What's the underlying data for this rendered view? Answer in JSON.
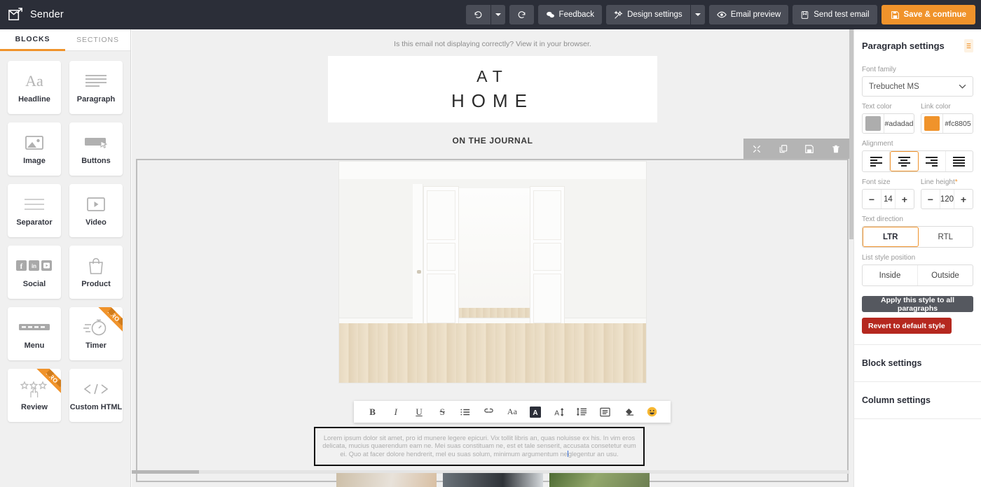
{
  "app": {
    "brand_name": "Sender",
    "brand_logo_icon": "envelope-arrow-icon"
  },
  "topbar": {
    "undo_icon": "undo-icon",
    "undo_dropdown_icon": "chevron-down-icon",
    "redo_icon": "redo-icon",
    "feedback_label": "Feedback",
    "feedback_icon": "chat-bubble-icon",
    "design_settings_label": "Design settings",
    "design_settings_icon": "wand-icon",
    "design_settings_dropdown_icon": "chevron-down-icon",
    "email_preview_label": "Email preview",
    "email_preview_icon": "eye-icon",
    "send_test_email_label": "Send test email",
    "send_test_email_icon": "paper-plane-icon",
    "save_label": "Save & continue",
    "save_icon": "floppy-disk-icon",
    "accent_color": "#f0932b",
    "bar_color": "#2b2e38"
  },
  "sidebar": {
    "tabs": [
      {
        "label": "BLOCKS",
        "active": true
      },
      {
        "label": "SECTIONS",
        "active": false
      }
    ],
    "blocks": [
      {
        "label": "Headline",
        "icon": "text-aa-icon",
        "pro": false
      },
      {
        "label": "Paragraph",
        "icon": "paragraph-lines-icon",
        "pro": false
      },
      {
        "label": "Image",
        "icon": "image-icon",
        "pro": false
      },
      {
        "label": "Buttons",
        "icon": "button-cursor-icon",
        "pro": false
      },
      {
        "label": "Separator",
        "icon": "separator-icon",
        "pro": false
      },
      {
        "label": "Video",
        "icon": "video-play-icon",
        "pro": false
      },
      {
        "label": "Social",
        "icon": "social-networks-icon",
        "pro": false
      },
      {
        "label": "Product",
        "icon": "shopping-bag-icon",
        "pro": false
      },
      {
        "label": "Menu",
        "icon": "menu-bar-icon",
        "pro": false
      },
      {
        "label": "Timer",
        "icon": "stopwatch-icon",
        "pro": true
      },
      {
        "label": "Review",
        "icon": "stars-hand-icon",
        "pro": true
      },
      {
        "label": "Custom HTML",
        "icon": "code-brackets-icon",
        "pro": false
      }
    ],
    "pro_badge": "PRO"
  },
  "canvas": {
    "preheader": "Is this email not displaying correctly? View it in your browser.",
    "logo_line1": "AT",
    "logo_line2": "HOME",
    "section_heading": "ON THE JOURNAL",
    "hero_image_alt": "empty-white-room-with-open-double-doors",
    "row_toolbar": [
      {
        "icon": "move-icon",
        "name": "move-row"
      },
      {
        "icon": "duplicate-icon",
        "name": "duplicate-row"
      },
      {
        "icon": "save-icon",
        "name": "save-row"
      },
      {
        "icon": "trash-icon",
        "name": "delete-row"
      }
    ],
    "block_handles": [
      {
        "icon": "move-icon",
        "name": "move-block"
      },
      {
        "icon": "duplicate-icon",
        "name": "duplicate-block"
      },
      {
        "icon": "trash-icon",
        "name": "delete-block"
      }
    ],
    "rte_tools": [
      {
        "icon": "bold-icon",
        "label": "B"
      },
      {
        "icon": "italic-icon",
        "label": "I"
      },
      {
        "icon": "underline-icon",
        "label": "U"
      },
      {
        "icon": "strikethrough-icon",
        "label": "S"
      },
      {
        "icon": "bullet-list-icon",
        "label": ""
      },
      {
        "icon": "link-icon",
        "label": ""
      },
      {
        "icon": "font-family-icon",
        "label": "Aa"
      },
      {
        "icon": "text-color-icon",
        "label": "A"
      },
      {
        "icon": "font-size-icon",
        "label": "A"
      },
      {
        "icon": "line-height-icon",
        "label": ""
      },
      {
        "icon": "align-icon",
        "label": ""
      },
      {
        "icon": "clear-format-icon",
        "label": ""
      },
      {
        "icon": "emoji-icon",
        "label": ""
      }
    ],
    "paragraph_text": "Lorem ipsum dolor sit amet, pro id munere legere epicuri. Vix tollit libris an, quas noluisse ex his. In vim eros delicata, mucius quaerendum eam ne. Mei suas constituam ne, est et tale senserit, accusata consetetur eum ei. Quo at facer dolore hendrerit, mel eu suas solum, minimum argumentum ne",
    "paragraph_text_tail": "glegentur an usu."
  },
  "right_panel": {
    "title": "Paragraph settings",
    "collapse_icon": "collapse-icon",
    "font_family_label": "Font family",
    "font_family_value": "Trebuchet MS",
    "text_color_label": "Text color",
    "text_color_value": "#adadad",
    "link_color_label": "Link color",
    "link_color_value": "#fc8805",
    "alignment_label": "Alignment",
    "alignment_options": [
      {
        "name": "align-left",
        "selected": false
      },
      {
        "name": "align-center",
        "selected": true
      },
      {
        "name": "align-right",
        "selected": false
      },
      {
        "name": "align-justify",
        "selected": false
      }
    ],
    "font_size_label": "Font size",
    "font_size_value": "14",
    "line_height_label": "Line height",
    "line_height_required": "*",
    "line_height_value": "120",
    "minus_label": "−",
    "plus_label": "+",
    "text_direction_label": "Text direction",
    "text_direction_options": [
      {
        "label": "LTR",
        "selected": true
      },
      {
        "label": "RTL",
        "selected": false
      }
    ],
    "list_style_label": "List style position",
    "list_style_options": [
      {
        "label": "Inside",
        "selected": false
      },
      {
        "label": "Outside",
        "selected": false
      }
    ],
    "apply_all_label": "Apply this style to all paragraphs",
    "revert_label": "Revert to default style",
    "block_settings_label": "Block settings",
    "column_settings_label": "Column settings"
  }
}
